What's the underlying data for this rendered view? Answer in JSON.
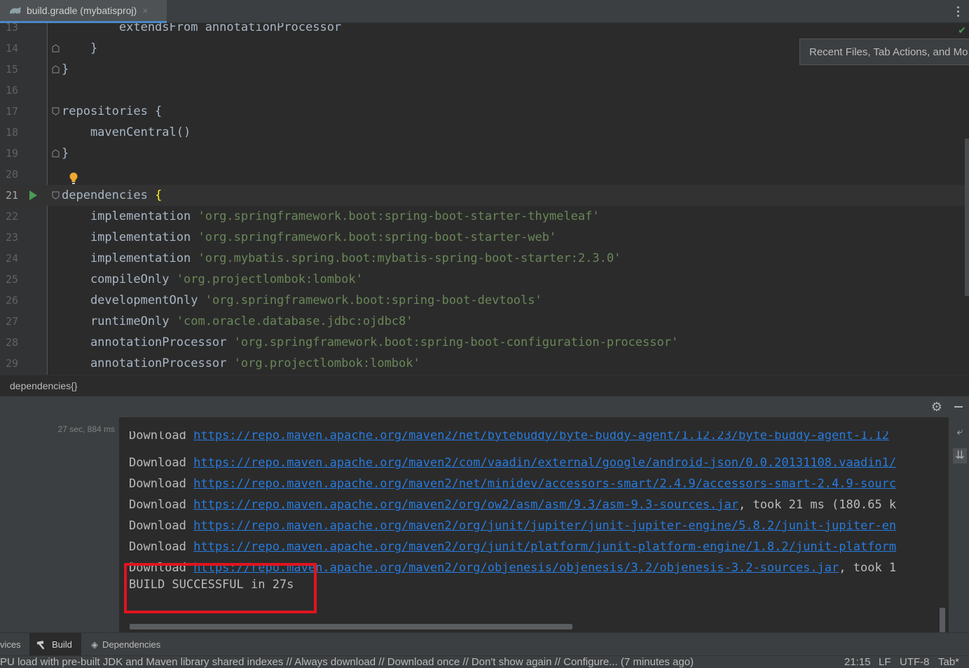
{
  "tab": {
    "label": "build.gradle (mybatisproj)",
    "close": "×"
  },
  "popup": {
    "text": "Recent Files, Tab Actions, and Mo"
  },
  "editor": {
    "lines": [
      {
        "num": "13",
        "text": "        extendsFrom annotationProcessor"
      },
      {
        "num": "14",
        "text": "    }"
      },
      {
        "num": "15",
        "text": "}"
      },
      {
        "num": "16",
        "text": ""
      },
      {
        "num": "17",
        "text": "repositories {"
      },
      {
        "num": "18",
        "text": "    mavenCentral()"
      },
      {
        "num": "19",
        "text": "}"
      },
      {
        "num": "20",
        "text": ""
      },
      {
        "num": "21",
        "text": "dependencies "
      },
      {
        "num": "22",
        "kw": "    implementation ",
        "str": "'org.springframework.boot:spring-boot-starter-thymeleaf'"
      },
      {
        "num": "23",
        "kw": "    implementation ",
        "str": "'org.springframework.boot:spring-boot-starter-web'"
      },
      {
        "num": "24",
        "kw": "    implementation ",
        "str": "'org.mybatis.spring.boot:mybatis-spring-boot-starter:2.3.0'"
      },
      {
        "num": "25",
        "kw": "    compileOnly ",
        "str": "'org.projectlombok:lombok'"
      },
      {
        "num": "26",
        "kw": "    developmentOnly ",
        "str": "'org.springframework.boot:spring-boot-devtools'"
      },
      {
        "num": "27",
        "kw": "    runtimeOnly ",
        "str": "'com.oracle.database.jdbc:ojdbc8'"
      },
      {
        "num": "28",
        "kw": "    annotationProcessor ",
        "str": "'org.springframework.boot:spring-boot-configuration-processor'"
      },
      {
        "num": "29",
        "kw": "    annotationProcessor ",
        "str": "'org.projectlombok:lombok'"
      }
    ],
    "open_brace": "{"
  },
  "breadcrumb": "dependencies{}",
  "build": {
    "time": "27 sec, 884 ms",
    "lines": [
      {
        "prefix": "Download ",
        "url": "https://repo.maven.apache.org/maven2/net/bytebuddy/byte-buddy-agent/1.12.23/byte-buddy-agent-1.12",
        "suffix": ""
      },
      {
        "prefix": "Download ",
        "url": "https://repo.maven.apache.org/maven2/com/vaadin/external/google/android-json/0.0.20131108.vaadin1/",
        "suffix": ""
      },
      {
        "prefix": "Download ",
        "url": "https://repo.maven.apache.org/maven2/net/minidev/accessors-smart/2.4.9/accessors-smart-2.4.9-sourc",
        "suffix": ""
      },
      {
        "prefix": "Download ",
        "url": "https://repo.maven.apache.org/maven2/org/ow2/asm/asm/9.3/asm-9.3-sources.jar",
        "suffix": ", took 21 ms (180.65 k"
      },
      {
        "prefix": "Download ",
        "url": "https://repo.maven.apache.org/maven2/org/junit/jupiter/junit-jupiter-engine/5.8.2/junit-jupiter-en",
        "suffix": ""
      },
      {
        "prefix": "Download ",
        "url": "https://repo.maven.apache.org/maven2/org/junit/platform/junit-platform-engine/1.8.2/junit-platform",
        "suffix": ""
      },
      {
        "prefix": "Download ",
        "url": "https://repo.maven.apache.org/maven2/org/objenesis/objenesis/3.2/objenesis-3.2-sources.jar",
        "suffix": ", took 1"
      }
    ],
    "result": "BUILD SUCCESSFUL in 27s"
  },
  "tool_tabs": {
    "services": "vices",
    "build": "Build",
    "dependencies": "Dependencies"
  },
  "status": {
    "message": "PU load with pre-built JDK and Maven library shared indexes // Always download // Download once // Don't show again // Configure... (7 minutes ago)",
    "position": "21:15",
    "line_sep": "LF",
    "encoding": "UTF-8",
    "indent": "Tab*"
  }
}
